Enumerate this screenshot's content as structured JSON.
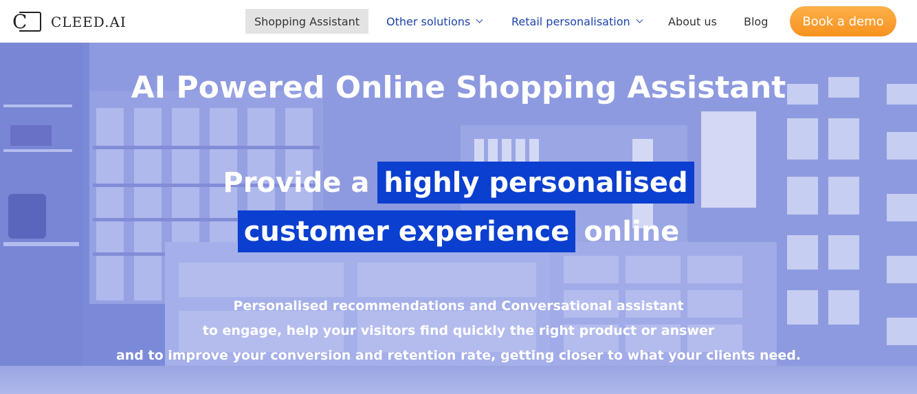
{
  "brand": {
    "logo_text": "CLEED.AI",
    "logo_mark": "C"
  },
  "nav": {
    "items": [
      {
        "label": "Shopping Assistant",
        "active": true
      },
      {
        "label": "Other solutions",
        "dropdown": true
      },
      {
        "label": "Retail personalisation",
        "dropdown": true
      },
      {
        "label": "About us"
      },
      {
        "label": "Blog"
      }
    ],
    "cta_label": "Book a demo"
  },
  "hero": {
    "title": "AI Powered Online Shopping Assistant",
    "line1_plain": "Provide a",
    "line1_highlight": "highly personalised",
    "line2_highlight": "customer experience",
    "line2_plain": "online",
    "description": [
      "Personalised recommendations and Conversational assistant",
      "to engage, help your visitors find quickly the right product or answer",
      "and to improve your conversion and retention rate, getting closer to what your clients need."
    ]
  },
  "colors": {
    "accent_blue": "#0b3fd0",
    "nav_link_blue": "#1c43a9",
    "cta_orange": "#f7921e",
    "hero_tint": "#8896dc"
  }
}
